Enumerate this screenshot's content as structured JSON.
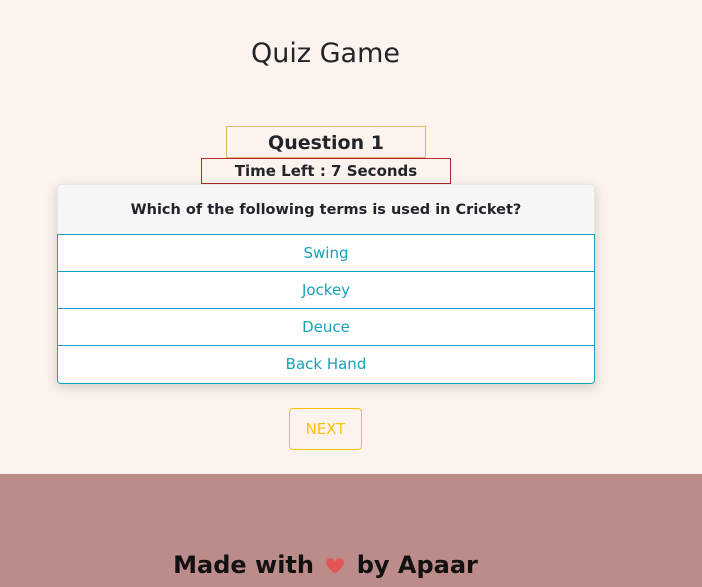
{
  "app": {
    "title": "Quiz Game"
  },
  "quiz": {
    "question_number": "Question 1",
    "timer_text": "Time Left : 7 Seconds",
    "question": "Which of the following terms is used in Cricket?",
    "options": [
      "Swing",
      "Jockey",
      "Deuce",
      "Back Hand"
    ],
    "next_label": "NEXT"
  },
  "footer": {
    "prefix": "Made with",
    "heart_icon": "heart-icon",
    "suffix": "by Apaar"
  },
  "colors": {
    "background": "#fdf3ee",
    "footer_bg": "#bb8c8a",
    "option_accent": "#17a2b8",
    "next_accent": "#ffc107",
    "question_border": "#e2b36c",
    "timer_border": "#b2292e",
    "heart": "#e25555"
  }
}
